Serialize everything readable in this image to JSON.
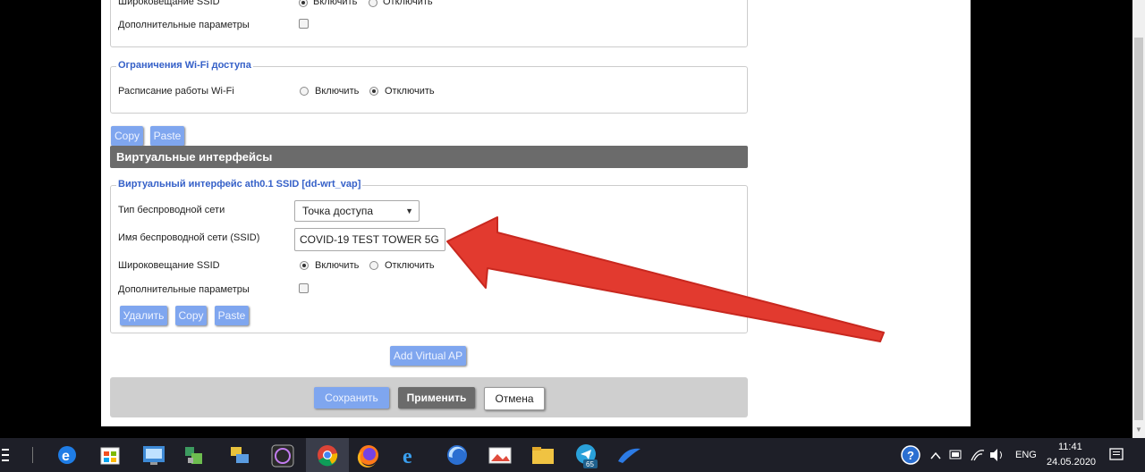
{
  "top_partial": {
    "broadcast_label": "Широковещание SSID",
    "enable_label": "Включить",
    "disable_label": "Отключить",
    "advanced_label": "Дополнительные параметры"
  },
  "wifi_restrictions": {
    "legend": "Ограничения Wi-Fi доступа",
    "schedule_label": "Расписание работы Wi-Fi",
    "enable_label": "Включить",
    "disable_label": "Отключить",
    "selected": "Отключить"
  },
  "copy_paste": {
    "copy": "Copy",
    "paste": "Paste"
  },
  "section_title": "Виртуальные интерфейсы",
  "virtual_interface": {
    "legend": "Виртуальный интерфейс ath0.1 SSID [dd-wrt_vap]",
    "mode_label": "Тип беспроводной сети",
    "mode_value": "Точка доступа",
    "ssid_label": "Имя беспроводной сети (SSID)",
    "ssid_value": "COVID-19 TEST TOWER 5G",
    "broadcast_label": "Широковещание SSID",
    "enable_label": "Включить",
    "disable_label": "Отключить",
    "broadcast_selected": "Включить",
    "advanced_label": "Дополнительные параметры",
    "buttons": {
      "delete": "Удалить",
      "copy": "Copy",
      "paste": "Paste"
    }
  },
  "add_virtual_ap": "Add Virtual AP",
  "footer": {
    "save": "Сохранить",
    "apply": "Применить",
    "cancel": "Отмена"
  },
  "annotation_arrow_color": "#e23a2f",
  "taskbar": {
    "language": "ENG",
    "time": "11:41",
    "date": "24.05.2020",
    "telegram_badge": "65",
    "icons": [
      "task-view-icon",
      "edge-icon",
      "store-icon",
      "network-map-icon",
      "app-icon",
      "network-icon",
      "winamp-icon",
      "chrome-icon",
      "firefox-icon",
      "ie-icon",
      "edge-legacy-icon",
      "photos-icon",
      "folder-icon",
      "telegram-icon",
      "app-swoosh-icon"
    ]
  }
}
